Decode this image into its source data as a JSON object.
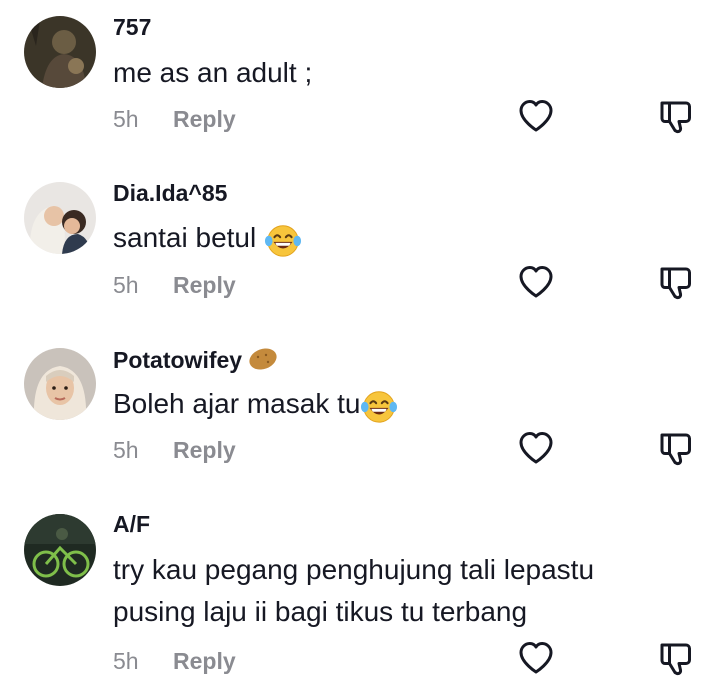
{
  "comments": [
    {
      "username": "757",
      "text": "me as an adult ;",
      "time": "5h",
      "reply_label": "Reply"
    },
    {
      "username": "Dia.Ida^85",
      "text": "santai betul",
      "emoji": "laughing-tears-emoji",
      "time": "5h",
      "reply_label": "Reply"
    },
    {
      "username": "Potatowifey",
      "username_emoji": "potato-emoji",
      "text": "Boleh ajar masak tu",
      "emoji": "laughing-tears-emoji",
      "time": "5h",
      "reply_label": "Reply"
    },
    {
      "username": "A/F",
      "text_lines": [
        "try kau pegang penghujung tali lepastu",
        "pusing laju ii bagi tikus tu terbang"
      ],
      "time": "5h",
      "reply_label": "Reply"
    }
  ],
  "colors": {
    "text": "#161823",
    "muted": "#8a8b91"
  }
}
